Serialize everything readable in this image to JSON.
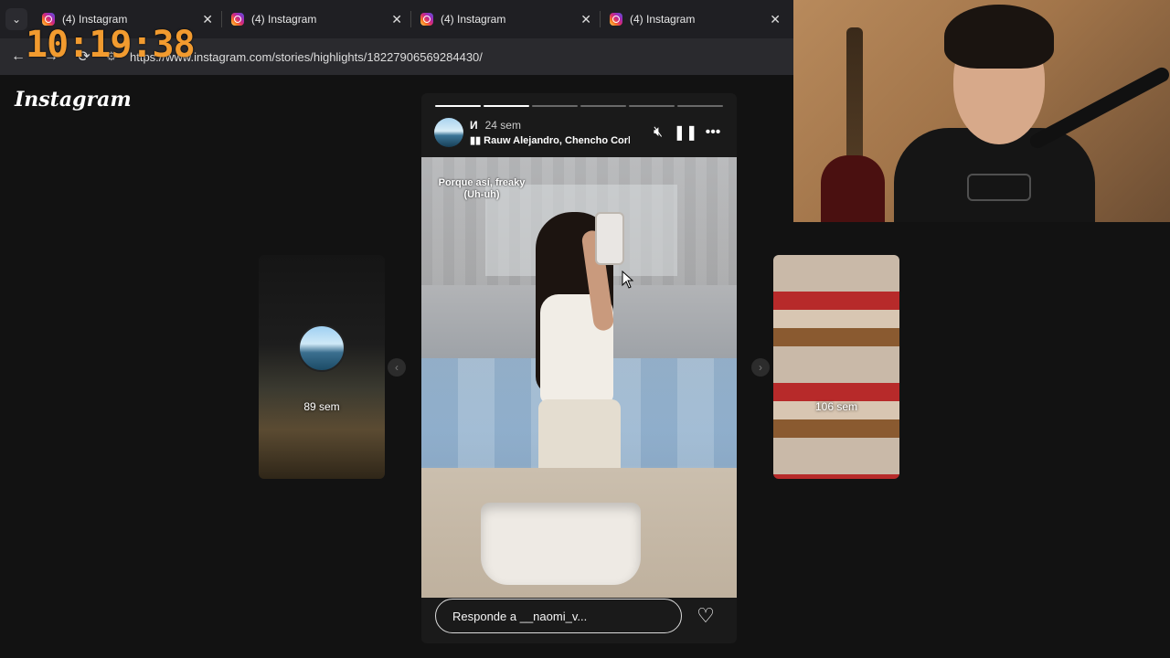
{
  "browser": {
    "tabs": [
      {
        "label": "(4) Instagram"
      },
      {
        "label": "(4) Instagram"
      },
      {
        "label": "(4) Instagram"
      },
      {
        "label": "(4) Instagram"
      }
    ],
    "url": "https://www.instagram.com/stories/highlights/18227906569284430/"
  },
  "overlay": {
    "clock": "10:19:38"
  },
  "instagram": {
    "logo": "Instagram",
    "prev_story": {
      "time": "89 sem"
    },
    "next_story": {
      "time": "106 sem"
    },
    "story": {
      "user": "И",
      "time": "24 sem",
      "music": "Rauw Alejandro, Chencho Corleone",
      "caption": "Porque así, freaky (Uh-uh)",
      "reply_placeholder": "Responde a __naomi_v...",
      "progress_segments": 6,
      "progress_current": 2
    }
  },
  "colors": {
    "clock": "#f29b2f",
    "background": "#121212"
  }
}
